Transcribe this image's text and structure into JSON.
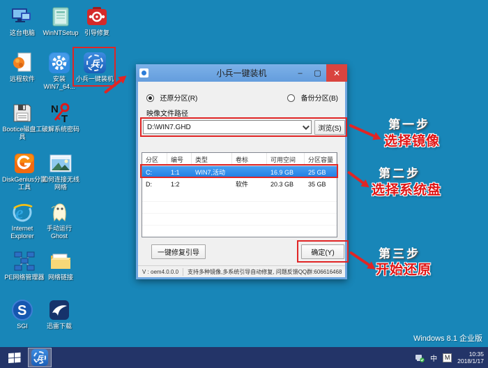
{
  "desktop": {
    "background": "#1886b8",
    "watermark": "Windows 8.1 企业版",
    "icons": [
      {
        "id": "this-pc",
        "icon": "computer-icon",
        "label": "这台电脑"
      },
      {
        "id": "winntsetup",
        "icon": "installer-box-icon",
        "label": "WinNTSetup"
      },
      {
        "id": "boot-repair",
        "icon": "red-toolbox-icon",
        "label": "引导修复"
      },
      {
        "id": "remote",
        "icon": "document-flame-icon",
        "label": "远程软件"
      },
      {
        "id": "install-win7",
        "icon": "gear-icon",
        "label": "安装 WIN7_64..."
      },
      {
        "id": "xiaobing",
        "icon": "xiaobing-logo-icon",
        "label": "小兵一键装机"
      },
      {
        "id": "bootice",
        "icon": "floppy-disk-icon",
        "label": "Bootice磁盘工具"
      },
      {
        "id": "nt-password",
        "icon": "nt-key-icon",
        "label": "破解系统密码"
      },
      {
        "id": "diskgenius",
        "icon": "diskgenius-g-icon",
        "label": "DiskGenius分区工具"
      },
      {
        "id": "wifi-help",
        "icon": "photo-icon",
        "label": "如何连接无线网络"
      },
      {
        "id": "ie",
        "icon": "ie-e-icon",
        "label": "Internet Explorer"
      },
      {
        "id": "ghost",
        "icon": "ghost-icon",
        "label": "手动运行 Ghost"
      },
      {
        "id": "pe-network",
        "icon": "network-nodes-icon",
        "label": "PE网络管理器"
      },
      {
        "id": "net-link",
        "icon": "folder-icon",
        "label": "网络链接"
      },
      {
        "id": "sgi",
        "icon": "sgi-s-icon",
        "label": "SGI"
      },
      {
        "id": "xunlei",
        "icon": "bird-icon",
        "label": "迅雷下载"
      }
    ]
  },
  "dialog": {
    "title": "小兵一键装机",
    "minimize": "–",
    "maximize": "▢",
    "close": "✕",
    "radio_restore": "还原分区(R)",
    "radio_backup": "备份分区(B)",
    "path_label": "映像文件路径",
    "path_value": "D:\\WIN7.GHD",
    "browse_button": "浏览(S)",
    "table": {
      "headers": [
        "分区",
        "编号",
        "类型",
        "卷标",
        "可用空间",
        "分区容量"
      ],
      "rows": [
        [
          "C:",
          "1:1",
          "WIN7,活动",
          "",
          "16.9 GB",
          "25 GB"
        ],
        [
          "D:",
          "1:2",
          "",
          "软件",
          "20.3 GB",
          "35 GB"
        ]
      ]
    },
    "fix_boot_button": "一键修复引导",
    "ok_button": "确定(Y)",
    "version": "V : oem4.0.0.0",
    "status": "支持多种镜像,多系统引导自动修复, 问题反馈QQ群:606616468"
  },
  "annotations": {
    "accent_color": "#e02525",
    "steps": [
      {
        "title": "第一步",
        "action": "选择镜像"
      },
      {
        "title": "第二步",
        "action": "选择系统盘"
      },
      {
        "title": "第三步",
        "action": "开始还原"
      }
    ]
  },
  "taskbar": {
    "background": "#233468",
    "ime_cn": "中",
    "ime_m": "M",
    "clock_time": "10:35",
    "clock_date": "2018/1/17"
  },
  "colors": {
    "titlebar": "#6ea6e0",
    "selection": "#2f8ce8",
    "close_button": "#d9443f"
  }
}
